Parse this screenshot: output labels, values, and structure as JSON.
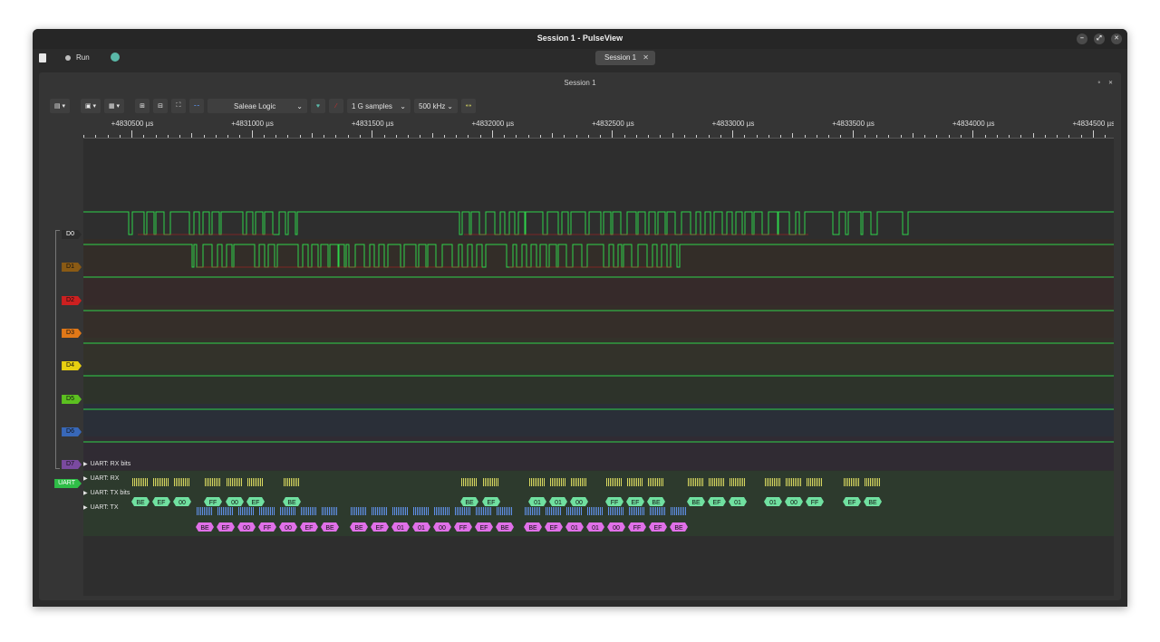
{
  "window": {
    "title": "Session 1 - PulseView"
  },
  "window_controls": {
    "minimize": "–",
    "maximize": "⤢",
    "close": "✕"
  },
  "appbar": {
    "run_label": "Run",
    "session_tab": "Session 1",
    "session_tab_close": "✕"
  },
  "session": {
    "title": "Session 1"
  },
  "panel_controls": "⚬ ✕",
  "toolbar": {
    "device": "Saleae Logic",
    "samples": "1 G samples",
    "samplerate": "500 kHz"
  },
  "ruler": {
    "labels": [
      "+4830500 µs",
      "+4831000 µs",
      "+4831500 µs",
      "+4832000 µs",
      "+4832500 µs",
      "+4833000 µs",
      "+4833500 µs",
      "+4834000 µs",
      "+4834500 µs"
    ]
  },
  "channels": [
    {
      "name": "D0",
      "color": "#2c2c2c",
      "text": "#ffffff"
    },
    {
      "name": "D1",
      "color": "#8a5a14",
      "text": "#111111"
    },
    {
      "name": "D2",
      "color": "#cc2020",
      "text": "#111111"
    },
    {
      "name": "D3",
      "color": "#e07818",
      "text": "#111111"
    },
    {
      "name": "D4",
      "color": "#e8d010",
      "text": "#111111"
    },
    {
      "name": "D5",
      "color": "#5cc020",
      "text": "#111111"
    },
    {
      "name": "D6",
      "color": "#3868b8",
      "text": "#111111"
    },
    {
      "name": "D7",
      "color": "#7a4aa0",
      "text": "#111111"
    }
  ],
  "decoder": {
    "badge": "UART",
    "rows": [
      "UART: RX bits",
      "UART: RX",
      "UART: TX bits",
      "UART: TX"
    ],
    "rx_bytes": [
      "BE",
      "EF",
      "00",
      "FF",
      "00",
      "EF",
      "BE",
      "BE",
      "EF",
      "01",
      "01",
      "00",
      "FF",
      "EF",
      "BE",
      "BE",
      "EF",
      "01",
      "01",
      "00",
      "FF",
      "EF",
      "BE"
    ],
    "tx_bytes": [
      "BE",
      "EF",
      "00",
      "FF",
      "00",
      "EF",
      "BE",
      "BE",
      "EF",
      "01",
      "01",
      "00",
      "FF",
      "EF",
      "BE",
      "BE",
      "EF",
      "01",
      "01",
      "00",
      "FF",
      "EF",
      "BE"
    ]
  },
  "colors": {
    "signal": "#2fd34a",
    "low_segment": "#c02020",
    "rx_bits": "#d8d860",
    "rx_byte": "#70e0a0",
    "tx_bits": "#6090e8",
    "tx_byte": "#e070e8"
  }
}
